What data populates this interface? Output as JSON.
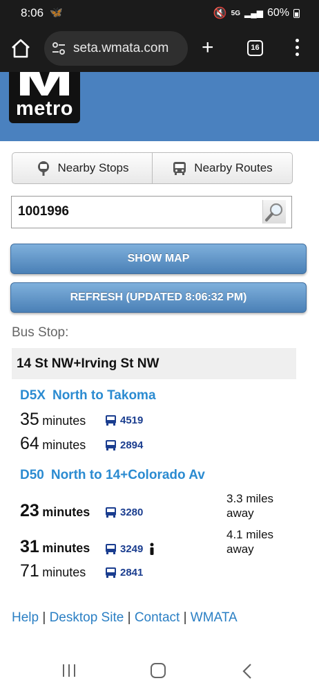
{
  "status_bar": {
    "time": "8:06",
    "battery": "60%",
    "network": "5G"
  },
  "browser": {
    "url": "seta.wmata.com",
    "tab_count": "16"
  },
  "site": {
    "logo_text": "metro"
  },
  "segments": [
    {
      "label": "Nearby Stops"
    },
    {
      "label": "Nearby Routes"
    }
  ],
  "search": {
    "value": "1001996"
  },
  "buttons": {
    "show_map": "SHOW MAP",
    "refresh": "REFRESH (UPDATED 8:06:32 PM)"
  },
  "stop": {
    "label": "Bus Stop:",
    "name": "14 St NW+Irving St NW"
  },
  "routes": [
    {
      "number": "D5X",
      "direction": "North to Takoma",
      "arrivals": [
        {
          "minutes": "35",
          "unit": "minutes",
          "bus": "4519",
          "distance": "",
          "bold": false,
          "person": false
        },
        {
          "minutes": "64",
          "unit": "minutes",
          "bus": "2894",
          "distance": "",
          "bold": false,
          "person": false
        }
      ]
    },
    {
      "number": "D50",
      "direction": "North to 14+Colorado Av",
      "arrivals": [
        {
          "minutes": "23",
          "unit": "minutes",
          "bus": "3280",
          "distance": "3.3 miles away",
          "bold": true,
          "person": false
        },
        {
          "minutes": "31",
          "unit": "minutes",
          "bus": "3249",
          "distance": "4.1 miles away",
          "bold": true,
          "person": true
        },
        {
          "minutes": "71",
          "unit": "minutes",
          "bus": "2841",
          "distance": "",
          "bold": false,
          "person": false
        }
      ]
    }
  ],
  "footer": {
    "help": "Help",
    "desktop": "Desktop Site",
    "contact": "Contact",
    "wmata": "WMATA",
    "separator": "|"
  }
}
